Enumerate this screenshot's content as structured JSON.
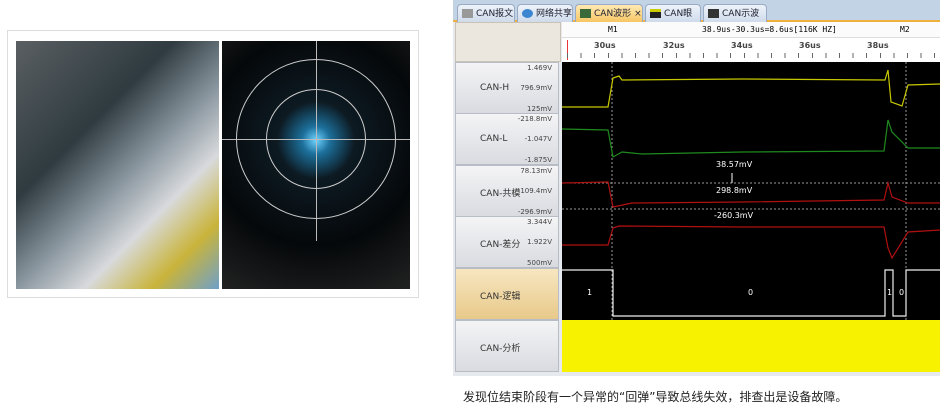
{
  "tabs": [
    {
      "label": "CAN报文",
      "icon": "message-icon"
    },
    {
      "label": "网络共享",
      "icon": "globe-icon"
    },
    {
      "label": "CAN波形",
      "icon": "waveform-icon",
      "active": true,
      "close": "×"
    },
    {
      "label": "CAN眼图",
      "icon": "eye-diagram-icon"
    },
    {
      "label": "CAN示波器",
      "icon": "oscilloscope-icon"
    }
  ],
  "markers": {
    "m1": "M1",
    "m2": "M2",
    "measurement": "38.9us-30.3us=8.6us[116K HZ]"
  },
  "time_ticks": [
    "30us",
    "32us",
    "34us",
    "36us",
    "38us"
  ],
  "channels": [
    {
      "name": "CAN-H",
      "top": "1.469V",
      "mid": "796.9mV",
      "bottom": "125mV",
      "color": "#c8c800"
    },
    {
      "name": "CAN-L",
      "top": "-218.8mV",
      "mid": "-1.047V",
      "bottom": "-1.875V",
      "color": "#1a7a1a"
    },
    {
      "name": "CAN-共模",
      "top": "78.13mV",
      "mid": "-109.4mV",
      "bottom": "-296.9mV",
      "color": "#b01010"
    },
    {
      "name": "CAN-差分",
      "top": "3.344V",
      "mid": "1.922V",
      "bottom": "500mV",
      "color": "#b01010"
    },
    {
      "name": "CAN-逻辑"
    },
    {
      "name": "CAN-分析"
    }
  ],
  "annotations": {
    "upper": "38.57mV",
    "delta": "298.8mV",
    "lower": "-260.3mV"
  },
  "logic_bits": [
    "1",
    "0",
    "1",
    "0"
  ],
  "analysis_color": "#f7f200",
  "caption": "发现位结束阶段有一个异常的“回弹”导致总线失效，排查出是设备故障。"
}
